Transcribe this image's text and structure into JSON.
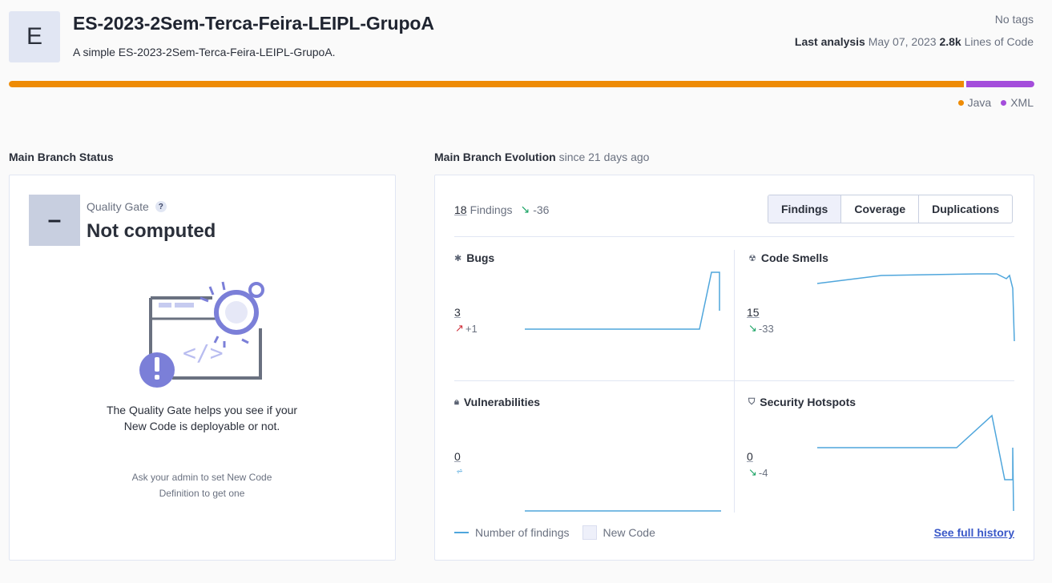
{
  "project": {
    "avatar_letter": "E",
    "title": "ES-2023-2Sem-Terca-Feira-LEIPL-GrupoA",
    "description": "A simple ES-2023-2Sem-Terca-Feira-LEIPL-GrupoA.",
    "tags": "No tags",
    "last_analysis_label": "Last analysis",
    "last_analysis_date": "May 07, 2023",
    "lines_of_code_value": "2.8k",
    "lines_of_code_label": "Lines of Code"
  },
  "languages": [
    {
      "name": "Java",
      "color": "#ee8b05"
    },
    {
      "name": "XML",
      "color": "#a44ddb"
    }
  ],
  "branch_status": {
    "title": "Main Branch Status",
    "quality_gate_symbol": "–",
    "quality_gate_label": "Quality Gate",
    "help_symbol": "?",
    "quality_gate_status": "Not computed",
    "help_text": "The Quality Gate helps you see if your New Code is deployable or not.",
    "note": "Ask your admin to set New Code Definition to get one"
  },
  "evolution": {
    "title": "Main Branch Evolution",
    "since": "since 21 days ago",
    "findings_count": "18",
    "findings_label": "Findings",
    "findings_delta": "-36",
    "tabs": [
      "Findings",
      "Coverage",
      "Duplications"
    ],
    "active_tab": "Findings",
    "metrics": {
      "bugs": {
        "title": "Bugs",
        "icon": "bug-icon",
        "value": "3",
        "delta": "+1",
        "trend": "up"
      },
      "code_smells": {
        "title": "Code Smells",
        "icon": "code-smell-icon",
        "value": "15",
        "delta": "-33",
        "trend": "down"
      },
      "vulnerabilities": {
        "title": "Vulnerabilities",
        "icon": "lock-icon",
        "value": "0",
        "delta": "",
        "trend": "none"
      },
      "security_hotspots": {
        "title": "Security Hotspots",
        "icon": "shield-icon",
        "value": "0",
        "delta": "-4",
        "trend": "down"
      }
    },
    "legend_findings": "Number of findings",
    "legend_new_code": "New Code",
    "history_link": "See full history",
    "line_color": "#4fa6dc"
  }
}
